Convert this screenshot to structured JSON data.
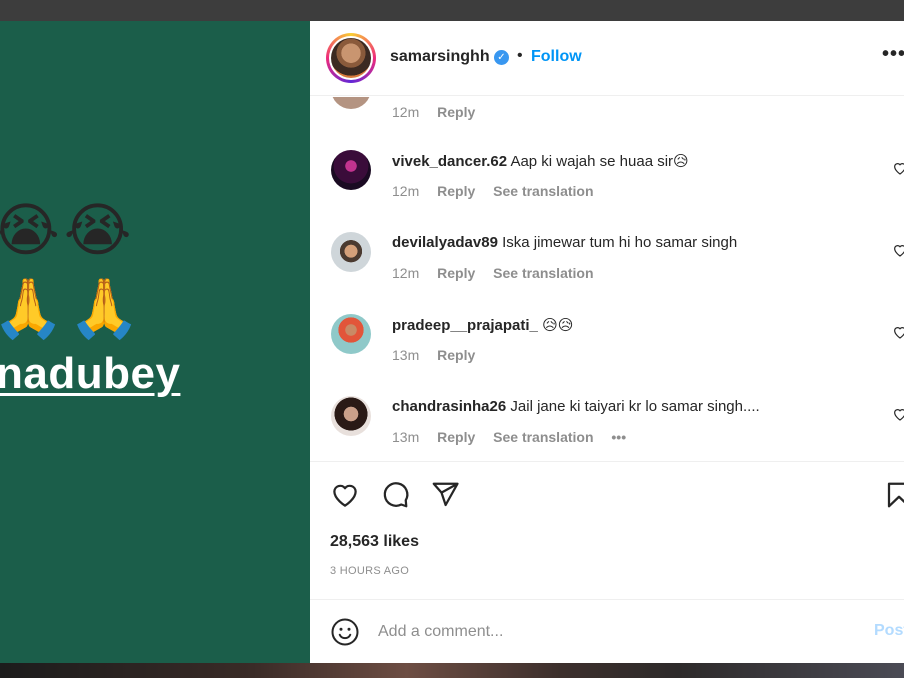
{
  "post_media": {
    "emoji_row_1": "😭😭",
    "emoji_row_2": "🙏🙏",
    "handle_text": "nadubey"
  },
  "header": {
    "username": "samarsinghh",
    "verified_icon": "verified-badge-icon",
    "separator": "•",
    "follow_label": "Follow",
    "more_icon": "more-options-icon"
  },
  "comments": [
    {
      "user": "",
      "text": "",
      "time": "12m",
      "reply": "Reply",
      "translation": ""
    },
    {
      "user": "vivek_dancer.62",
      "text": "Aap ki wajah se huaa sir😥",
      "time": "12m",
      "reply": "Reply",
      "translation": "See translation"
    },
    {
      "user": "devilalyadav89",
      "text": "Iska jimewar tum hi ho samar singh",
      "time": "12m",
      "reply": "Reply",
      "translation": "See translation"
    },
    {
      "user": "pradeep__prajapati_",
      "text": "😥😥",
      "time": "13m",
      "reply": "Reply",
      "translation": ""
    },
    {
      "user": "chandrasinha26",
      "text": "Jail jane ki taiyari kr lo samar singh....",
      "time": "13m",
      "reply": "Reply",
      "translation": "See translation",
      "more": "•••"
    }
  ],
  "actions": {
    "like_icon": "heart-icon",
    "comment_icon": "comment-icon",
    "share_icon": "share-icon",
    "save_icon": "bookmark-icon",
    "likes": "28,563 likes",
    "time_ago": "3 HOURS AGO"
  },
  "add_comment": {
    "emoji_icon": "smile-icon",
    "placeholder": "Add a comment...",
    "post_label": "Post"
  },
  "colors": {
    "media_bg": "#1b5e4a",
    "link_blue": "#0095f6",
    "muted": "#8e8e8e"
  }
}
